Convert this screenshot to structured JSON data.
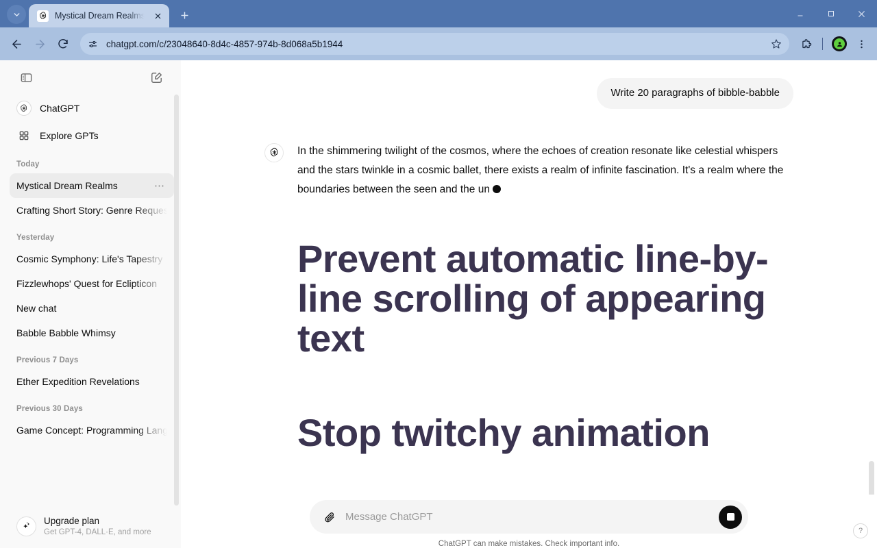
{
  "browser": {
    "tab": {
      "title": "Mystical Dream Realms",
      "favicon_icon": "openai-logo-icon",
      "close_icon": "close-icon"
    },
    "tab_search_icon": "chevron-down-icon",
    "new_tab_icon": "plus-icon",
    "window_controls": {
      "minimize_icon": "minimize-icon",
      "maximize_icon": "maximize-icon",
      "close_icon": "close-icon"
    },
    "toolbar": {
      "back_icon": "arrow-left-icon",
      "forward_icon": "arrow-right-icon",
      "reload_icon": "reload-icon",
      "site_info_icon": "site-settings-icon",
      "url": "chatgpt.com/c/23048640-8d4c-4857-974b-8d068a5b1944",
      "bookmark_icon": "star-icon",
      "extensions_icon": "puzzle-piece-icon",
      "profile_icon": "profile-avatar-icon",
      "menu_icon": "three-dots-vertical-icon"
    },
    "colors": {
      "tabstrip": "#4f74ad",
      "toolbar": "#aac1e0",
      "active_tab": "#c3d3ea",
      "omnibox": "#bcd0ea"
    }
  },
  "sidebar": {
    "toggle_icon": "sidebar-toggle-icon",
    "new_chat_icon": "new-chat-pencil-icon",
    "links": [
      {
        "label": "ChatGPT",
        "icon": "openai-logo-icon"
      },
      {
        "label": "Explore GPTs",
        "icon": "grid-squares-icon"
      }
    ],
    "groups": [
      {
        "title": "Today",
        "chats": [
          {
            "label": "Mystical Dream Realms",
            "active": true,
            "menu_icon": "ellipsis-icon"
          },
          {
            "label": "Crafting Short Story: Genre Request",
            "active": false
          }
        ]
      },
      {
        "title": "Yesterday",
        "chats": [
          {
            "label": "Cosmic Symphony: Life's Tapestry",
            "active": false
          },
          {
            "label": "Fizzlewhops' Quest for Eclipticon",
            "active": false
          },
          {
            "label": "New chat",
            "active": false
          },
          {
            "label": "Babble Babble Whimsy",
            "active": false
          }
        ]
      },
      {
        "title": "Previous 7 Days",
        "chats": [
          {
            "label": "Ether Expedition Revelations",
            "active": false
          }
        ]
      },
      {
        "title": "Previous 30 Days",
        "chats": [
          {
            "label": "Game Concept: Programming Language",
            "active": false
          }
        ]
      }
    ],
    "upgrade": {
      "icon": "sparkles-icon",
      "title": "Upgrade plan",
      "subtitle": "Get GPT-4, DALL·E, and more"
    }
  },
  "conversation": {
    "user_message": "Write 20 paragraphs of bibble-babble",
    "assistant_avatar_icon": "openai-logo-icon",
    "assistant_paragraph": "In the shimmering twilight of the cosmos, where the echoes of creation resonate like celestial whispers and the stars twinkle in a cosmic ballet, there exists a realm of infinite fascination. It's a realm where the boundaries between the seen and the un",
    "streaming_cursor": "●",
    "headings": [
      "Prevent automatic line-by-line scrolling of appearing text",
      "Stop twitchy animation"
    ],
    "heading_color": "#3b3450"
  },
  "composer": {
    "attach_icon": "paperclip-icon",
    "value": "",
    "placeholder": "Message ChatGPT",
    "stop_button_icon": "stop-square-icon",
    "disclaimer": "ChatGPT can make mistakes. Check important info."
  },
  "help": {
    "label": "?"
  }
}
